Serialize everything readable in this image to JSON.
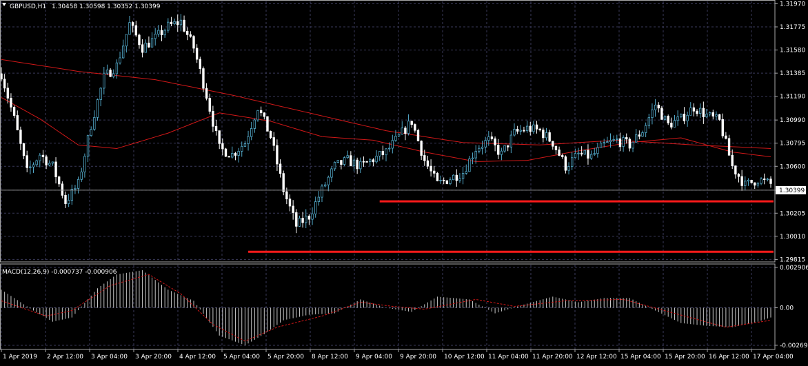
{
  "header": {
    "symbol_tf": "GBPUSD,H1",
    "ohlc": "1.30458 1.30598 1.30352 1.30399"
  },
  "macd_header": {
    "label": "MACD(12,26,9) -0.000737 -0.000906"
  },
  "colors": {
    "background": "#000000",
    "grid": "#3a3a5a",
    "frame": "#a8a8a8",
    "bull_candle": "#52a8c8",
    "bear_candle": "#ffffff",
    "ma_line": "#d01818",
    "support_line": "#ff1a1a",
    "macd_hist": "#c8c8c8",
    "macd_signal": "#d01818"
  },
  "price_axis": {
    "ticks": [
      "1.31970",
      "1.31775",
      "1.31580",
      "1.31385",
      "1.31190",
      "1.30990",
      "1.30795",
      "1.30600",
      "1.30399",
      "1.30205",
      "1.30010",
      "1.29815"
    ],
    "current_price": "1.30399"
  },
  "macd_axis": {
    "ticks": [
      "0.002906",
      "0.00",
      "-0.002699"
    ]
  },
  "time_axis": {
    "labels": [
      "1 Apr 2019",
      "2 Apr 12:00",
      "3 Apr 04:00",
      "3 Apr 20:00",
      "4 Apr 12:00",
      "5 Apr 04:00",
      "5 Apr 20:00",
      "8 Apr 12:00",
      "9 Apr 04:00",
      "9 Apr 20:00",
      "10 Apr 12:00",
      "11 Apr 04:00",
      "11 Apr 20:00",
      "12 Apr 12:00",
      "15 Apr 04:00",
      "15 Apr 20:00",
      "16 Apr 12:00",
      "17 Apr 04:00"
    ]
  },
  "chart_data": {
    "type": "candlestick",
    "symbol": "GBPUSD",
    "timeframe": "H1",
    "ylim": [
      1.298,
      1.3199
    ],
    "close_path": [
      [
        0,
        1.3138
      ],
      [
        4,
        1.31
      ],
      [
        8,
        1.3055
      ],
      [
        12,
        1.307
      ],
      [
        16,
        1.306
      ],
      [
        20,
        1.303
      ],
      [
        24,
        1.3045
      ],
      [
        28,
        1.3095
      ],
      [
        32,
        1.3135
      ],
      [
        36,
        1.3145
      ],
      [
        40,
        1.318
      ],
      [
        44,
        1.316
      ],
      [
        48,
        1.3168
      ],
      [
        52,
        1.3178
      ],
      [
        56,
        1.3182
      ],
      [
        60,
        1.316
      ],
      [
        64,
        1.312
      ],
      [
        68,
        1.3075
      ],
      [
        72,
        1.307
      ],
      [
        76,
        1.308
      ],
      [
        80,
        1.311
      ],
      [
        84,
        1.3085
      ],
      [
        88,
        1.304
      ],
      [
        92,
        1.301
      ],
      [
        96,
        1.3018
      ],
      [
        100,
        1.304
      ],
      [
        104,
        1.306
      ],
      [
        108,
        1.3065
      ],
      [
        112,
        1.306
      ],
      [
        116,
        1.3066
      ],
      [
        120,
        1.3072
      ],
      [
        124,
        1.3085
      ],
      [
        128,
        1.3098
      ],
      [
        132,
        1.3065
      ],
      [
        136,
        1.3045
      ],
      [
        140,
        1.305
      ],
      [
        144,
        1.3055
      ],
      [
        148,
        1.3075
      ],
      [
        152,
        1.3082
      ],
      [
        156,
        1.307
      ],
      [
        160,
        1.3088
      ],
      [
        164,
        1.3092
      ],
      [
        168,
        1.309
      ],
      [
        172,
        1.308
      ],
      [
        176,
        1.306
      ],
      [
        180,
        1.307
      ],
      [
        184,
        1.3068
      ],
      [
        188,
        1.3078
      ],
      [
        192,
        1.3082
      ],
      [
        196,
        1.3078
      ],
      [
        200,
        1.309
      ],
      [
        204,
        1.3112
      ],
      [
        208,
        1.3095
      ],
      [
        212,
        1.31
      ],
      [
        216,
        1.311
      ],
      [
        220,
        1.3103
      ],
      [
        224,
        1.3098
      ],
      [
        228,
        1.306
      ],
      [
        232,
        1.3044
      ],
      [
        236,
        1.3049
      ],
      [
        240,
        1.3045
      ]
    ],
    "moving_averages": [
      {
        "name": "MA-slow",
        "path": [
          [
            0,
            1.315
          ],
          [
            24,
            1.314
          ],
          [
            48,
            1.3133
          ],
          [
            72,
            1.312
          ],
          [
            96,
            1.3105
          ],
          [
            120,
            1.309
          ],
          [
            144,
            1.308
          ],
          [
            168,
            1.3078
          ],
          [
            192,
            1.3082
          ],
          [
            216,
            1.3078
          ],
          [
            240,
            1.3075
          ]
        ]
      },
      {
        "name": "MA-fast",
        "path": [
          [
            0,
            1.3118
          ],
          [
            12,
            1.31
          ],
          [
            24,
            1.3078
          ],
          [
            36,
            1.3075
          ],
          [
            52,
            1.3088
          ],
          [
            68,
            1.3105
          ],
          [
            84,
            1.3098
          ],
          [
            100,
            1.3085
          ],
          [
            116,
            1.3082
          ],
          [
            132,
            1.3072
          ],
          [
            148,
            1.3064
          ],
          [
            164,
            1.3065
          ],
          [
            180,
            1.3073
          ],
          [
            196,
            1.308
          ],
          [
            212,
            1.3084
          ],
          [
            228,
            1.3072
          ],
          [
            240,
            1.3068
          ]
        ]
      }
    ],
    "support_lines": [
      {
        "price": 1.30305,
        "from_index": 118,
        "to_index": 240
      },
      {
        "price": 1.2988,
        "from_index": 77,
        "to_index": 240
      }
    ],
    "macd": {
      "ylim": [
        -0.003,
        0.0031
      ],
      "histogram_path": [
        [
          0,
          0.0013
        ],
        [
          10,
          -0.0002
        ],
        [
          16,
          -0.001
        ],
        [
          22,
          -0.0007
        ],
        [
          30,
          0.0014
        ],
        [
          36,
          0.0024
        ],
        [
          44,
          0.0027
        ],
        [
          52,
          0.0013
        ],
        [
          60,
          0.0005
        ],
        [
          68,
          -0.002
        ],
        [
          76,
          -0.0027
        ],
        [
          82,
          -0.0019
        ],
        [
          88,
          -0.0009
        ],
        [
          96,
          -0.0005
        ],
        [
          104,
          -0.0004
        ],
        [
          112,
          0.0006
        ],
        [
          120,
          0.0
        ],
        [
          128,
          -0.0003
        ],
        [
          136,
          0.0008
        ],
        [
          146,
          0.0006
        ],
        [
          154,
          -0.0004
        ],
        [
          164,
          0.0003
        ],
        [
          172,
          0.0008
        ],
        [
          180,
          0.0004
        ],
        [
          188,
          0.0007
        ],
        [
          196,
          0.0007
        ],
        [
          204,
          -0.0002
        ],
        [
          212,
          -0.0011
        ],
        [
          220,
          -0.0013
        ],
        [
          228,
          -0.0014
        ],
        [
          236,
          -0.001
        ],
        [
          240,
          -0.0007
        ]
      ],
      "signal_path": [
        [
          0,
          0.0005
        ],
        [
          14,
          -0.0006
        ],
        [
          22,
          -0.0002
        ],
        [
          34,
          0.0016
        ],
        [
          46,
          0.0024
        ],
        [
          56,
          0.001
        ],
        [
          66,
          -0.0012
        ],
        [
          76,
          -0.0024
        ],
        [
          86,
          -0.0014
        ],
        [
          100,
          -0.0006
        ],
        [
          112,
          0.0004
        ],
        [
          122,
          0.0001
        ],
        [
          132,
          -0.0001
        ],
        [
          148,
          0.0006
        ],
        [
          160,
          0.0001
        ],
        [
          176,
          0.0005
        ],
        [
          194,
          0.0006
        ],
        [
          210,
          -0.0004
        ],
        [
          226,
          -0.0014
        ],
        [
          240,
          -0.0009
        ]
      ]
    }
  }
}
